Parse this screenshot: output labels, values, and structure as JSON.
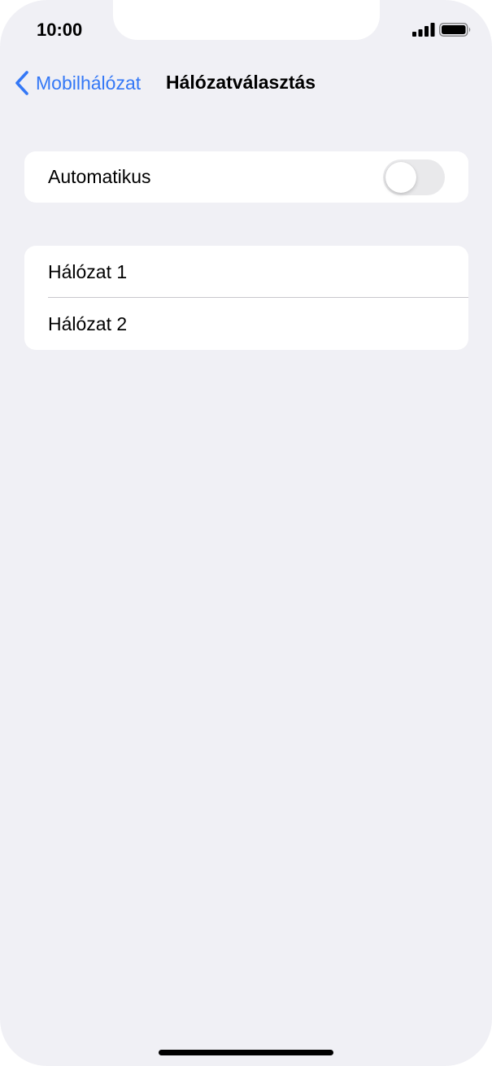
{
  "status_bar": {
    "time": "10:00",
    "icons": [
      "cellular-signal-icon",
      "battery-icon"
    ]
  },
  "nav": {
    "back_label": "Mobilhálózat",
    "title": "Hálózatválasztás",
    "back_icon": "chevron-left-icon"
  },
  "settings": {
    "automatic": {
      "label": "Automatikus",
      "enabled": false
    }
  },
  "networks": [
    {
      "label": "Hálózat 1"
    },
    {
      "label": "Hálózat 2"
    }
  ],
  "colors": {
    "accent": "#3478f6",
    "background": "#f0f0f5",
    "card": "#ffffff",
    "toggle_off": "#e9e9eb"
  }
}
